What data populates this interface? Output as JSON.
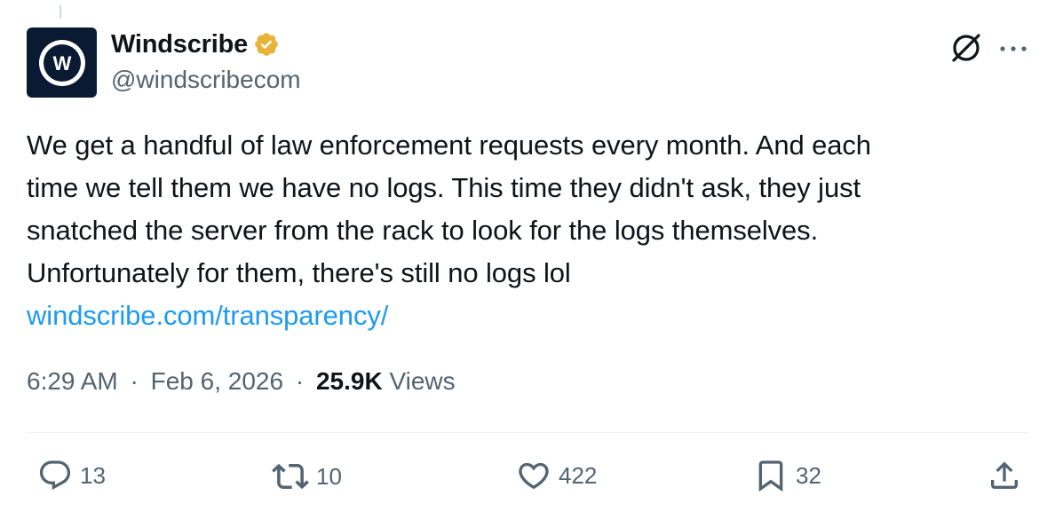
{
  "author": {
    "display_name": "Windscribe",
    "handle": "@windscribecom",
    "verified": true,
    "verified_badge_color": "#e8b339",
    "avatar_letter": "W"
  },
  "tweet": {
    "lines": [
      "We get a handful of law enforcement requests every month. And each",
      "time we tell them we have no logs. This time they didn't ask, they just",
      "snatched the server from the rack to look for the logs themselves.",
      "Unfortunately for them, there's still no logs lol"
    ],
    "link_text": "windscribe.com/transparency/",
    "link_color": "#1d9bf0"
  },
  "meta": {
    "time": "6:29 AM",
    "separator": "·",
    "date": "Feb 6, 2026",
    "views_count": "25.9K",
    "views_label": "Views"
  },
  "actions": {
    "replies": "13",
    "reposts": "10",
    "likes": "422",
    "bookmarks": "32"
  },
  "icons": {
    "header": [
      "grok-icon",
      "more-icon"
    ],
    "actions": [
      "reply-icon",
      "repost-icon",
      "like-icon",
      "bookmark-icon",
      "share-icon"
    ]
  }
}
